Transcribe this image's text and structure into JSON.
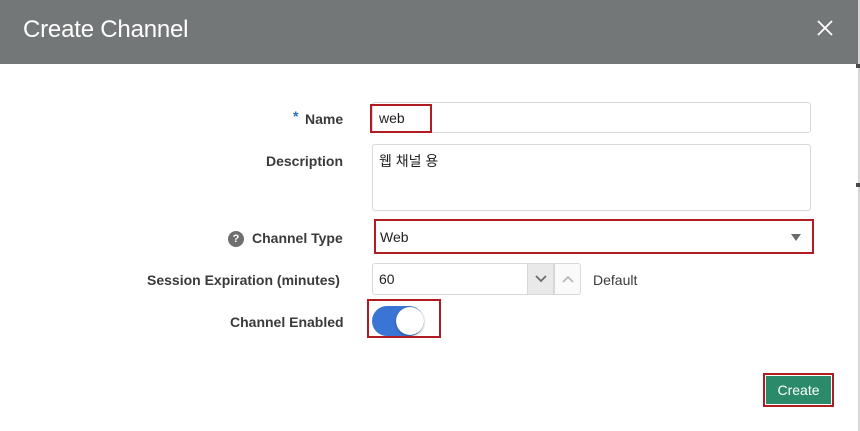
{
  "dialog": {
    "title": "Create Channel",
    "close_icon": "close-icon"
  },
  "form": {
    "name": {
      "label": "Name",
      "required_marker": "*",
      "value": "web"
    },
    "description": {
      "label": "Description",
      "value": "웹 채널 용"
    },
    "channel_type": {
      "label": "Channel Type",
      "help_icon": "?",
      "selected": "Web"
    },
    "session_expiration": {
      "label": "Session Expiration (minutes)",
      "value": "60",
      "default_text": "Default"
    },
    "channel_enabled": {
      "label": "Channel Enabled",
      "state": "on"
    }
  },
  "actions": {
    "create_label": "Create"
  },
  "colors": {
    "header_bg": "#747778",
    "toggle_on": "#3a74d4",
    "create_button": "#2a8a6a",
    "highlight": "#b01c22",
    "required": "#2b6cc4"
  }
}
